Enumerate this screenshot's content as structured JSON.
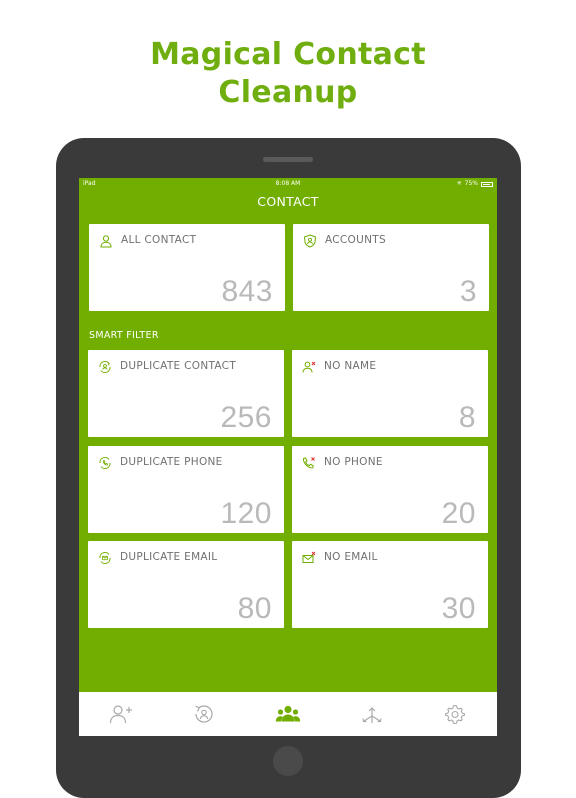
{
  "headline": {
    "line1": "Magical Contact",
    "line2": "Cleanup"
  },
  "status_bar": {
    "device": "iPad",
    "time": "8:08 AM",
    "battery": "75%"
  },
  "nav": {
    "title": "CONTACT"
  },
  "summary_cards": [
    {
      "label": "ALL CONTACT",
      "value": "843",
      "icon": "person-icon"
    },
    {
      "label": "ACCOUNTS",
      "value": "3",
      "icon": "account-shield-icon"
    }
  ],
  "smart_filter": {
    "title": "SMART FILTER",
    "cards": [
      {
        "label": "DUPLICATE CONTACT",
        "value": "256",
        "icon": "duplicate-contact-icon"
      },
      {
        "label": "NO NAME",
        "value": "8",
        "icon": "no-name-icon"
      },
      {
        "label": "DUPLICATE PHONE",
        "value": "120",
        "icon": "duplicate-phone-icon"
      },
      {
        "label": "NO PHONE",
        "value": "20",
        "icon": "no-phone-icon"
      },
      {
        "label": "DUPLICATE EMAIL",
        "value": "80",
        "icon": "duplicate-email-icon"
      },
      {
        "label": "NO EMAIL",
        "value": "30",
        "icon": "no-email-icon"
      }
    ]
  },
  "tab_bar": {
    "tabs": [
      {
        "icon": "add-contact-icon",
        "active": false
      },
      {
        "icon": "backup-restore-icon",
        "active": false
      },
      {
        "icon": "contacts-group-icon",
        "active": true
      },
      {
        "icon": "merge-icon",
        "active": false
      },
      {
        "icon": "settings-gear-icon",
        "active": false
      }
    ]
  },
  "colors": {
    "brand_green": "#72ae00",
    "headline_green": "#6fae0e",
    "value_gray": "#b9b9b9",
    "label_gray": "#707070",
    "icon_green": "#72ae00",
    "alert_red": "#e0302e"
  }
}
